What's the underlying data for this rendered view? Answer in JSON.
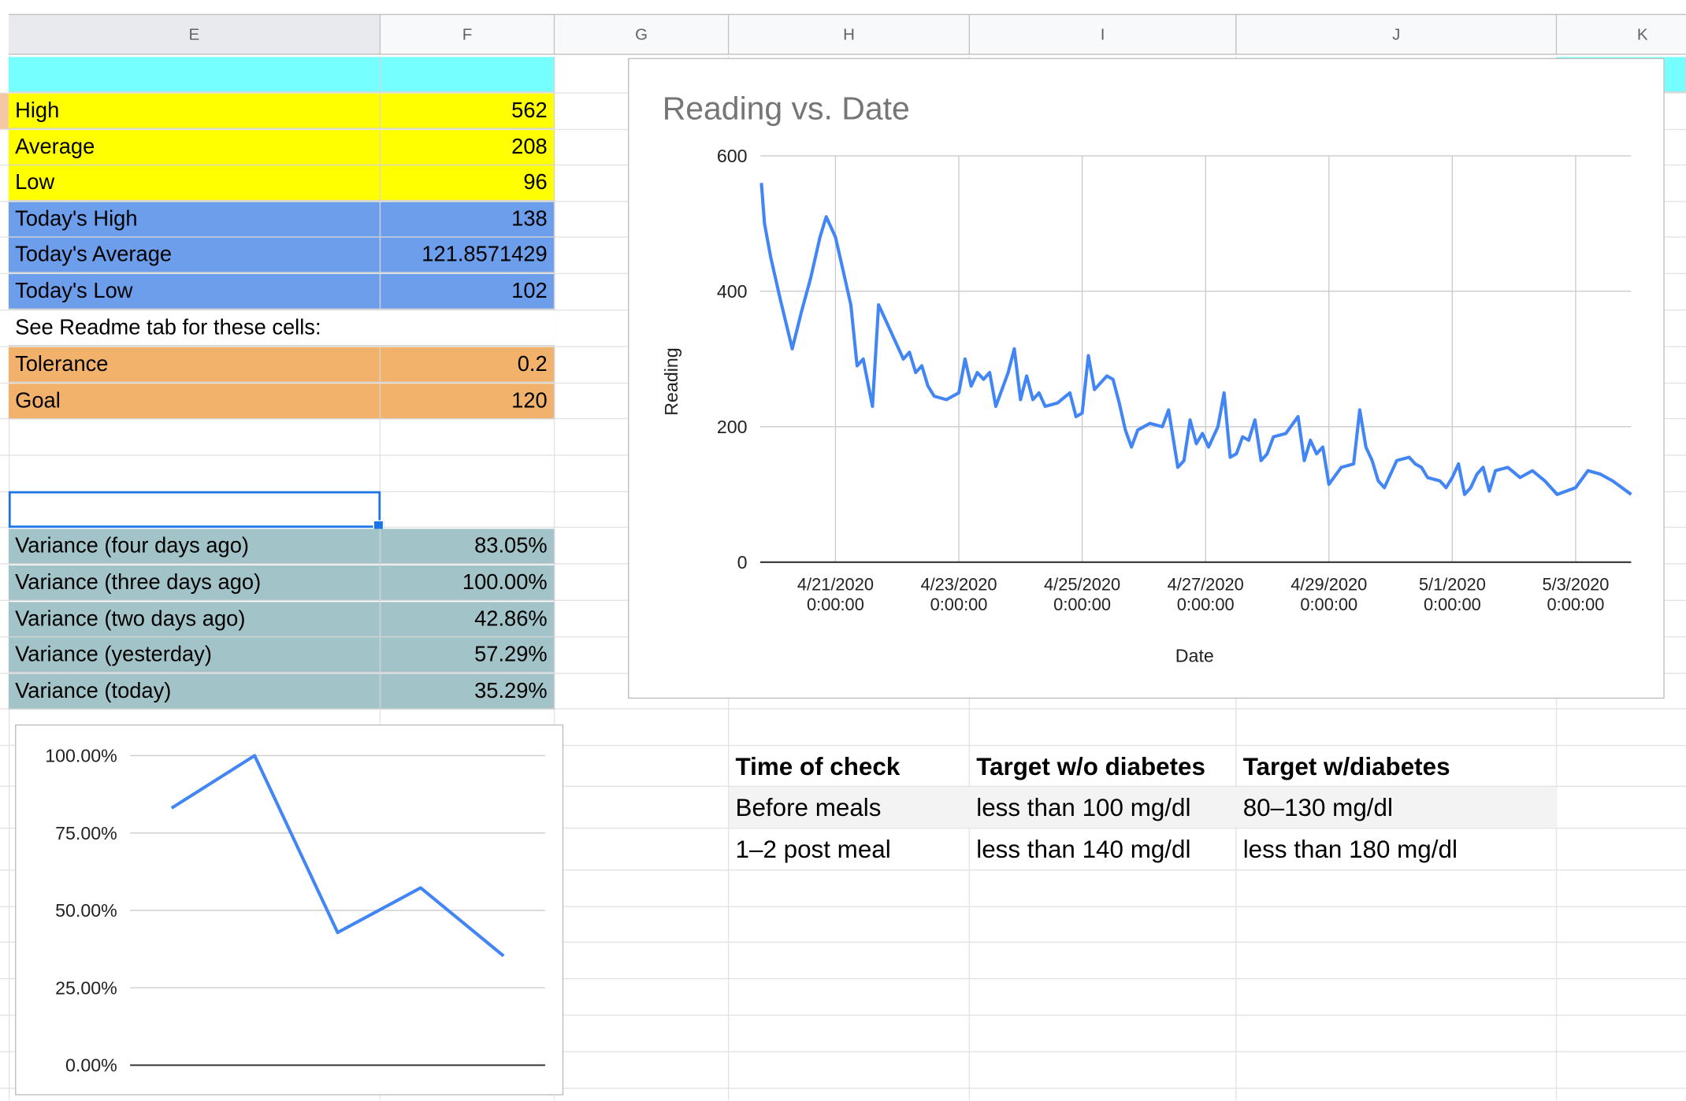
{
  "columns": [
    "E",
    "F",
    "G",
    "H",
    "I",
    "J",
    "K"
  ],
  "summary": {
    "high_label": "High",
    "high_value": "562",
    "average_label": "Average",
    "average_value": "208",
    "low_label": "Low",
    "low_value": "96",
    "today_high_label": "Today's High",
    "today_high_value": "138",
    "today_avg_label": "Today's Average",
    "today_avg_value": "121.8571429",
    "today_low_label": "Today's Low",
    "today_low_value": "102",
    "readme_note": "See Readme tab for these cells:",
    "tolerance_label": "Tolerance",
    "tolerance_value": "0.2",
    "goal_label": "Goal",
    "goal_value": "120"
  },
  "variance": [
    {
      "label": "Variance (four days ago)",
      "value": "83.05%"
    },
    {
      "label": "Variance (three days ago)",
      "value": "100.00%"
    },
    {
      "label": "Variance (two days ago)",
      "value": "42.86%"
    },
    {
      "label": "Variance (yesterday)",
      "value": "57.29%"
    },
    {
      "label": "Variance (today)",
      "value": "35.29%"
    }
  ],
  "reference_table": {
    "headers": [
      "Time of check",
      "Target w/o diabetes",
      "Target w/diabetes"
    ],
    "rows": [
      [
        "Before meals",
        "less than 100 mg/dl",
        "80–130 mg/dl"
      ],
      [
        "1–2 post meal",
        "less than 140 mg/dl",
        "less than 180 mg/dl"
      ]
    ]
  },
  "colors": {
    "yellow": "#ffff00",
    "blue": "#6d9eeb",
    "orange": "#f2b26b",
    "teal": "#a2c4c9",
    "cyan": "#76ffff",
    "series": "#4285f4",
    "selection": "#1a73e8"
  },
  "chart_data": [
    {
      "type": "line",
      "title": "Reading vs. Date",
      "xlabel": "Date",
      "ylabel": "Reading",
      "ylim": [
        0,
        600
      ],
      "yticks": [
        "0",
        "200",
        "400",
        "600"
      ],
      "xticks": [
        [
          "4/21/2020",
          "0:00:00"
        ],
        [
          "4/23/2020",
          "0:00:00"
        ],
        [
          "4/25/2020",
          "0:00:00"
        ],
        [
          "4/27/2020",
          "0:00:00"
        ],
        [
          "4/29/2020",
          "0:00:00"
        ],
        [
          "5/1/2020",
          "0:00:00"
        ],
        [
          "5/3/2020",
          "0:00:00"
        ]
      ],
      "xtick_days": [
        1,
        3,
        5,
        7,
        9,
        11,
        13
      ],
      "xlim_days": [
        -0.22,
        13.9
      ],
      "series": [
        {
          "points": [
            [
              -0.2,
              560
            ],
            [
              -0.15,
              500
            ],
            [
              -0.05,
              450
            ],
            [
              0.1,
              390
            ],
            [
              0.3,
              315
            ],
            [
              0.45,
              370
            ],
            [
              0.6,
              420
            ],
            [
              0.75,
              480
            ],
            [
              0.85,
              510
            ],
            [
              1.0,
              480
            ],
            [
              1.15,
              420
            ],
            [
              1.25,
              380
            ],
            [
              1.35,
              290
            ],
            [
              1.45,
              300
            ],
            [
              1.6,
              230
            ],
            [
              1.7,
              380
            ],
            [
              1.8,
              360
            ],
            [
              1.95,
              330
            ],
            [
              2.1,
              300
            ],
            [
              2.2,
              310
            ],
            [
              2.3,
              280
            ],
            [
              2.4,
              290
            ],
            [
              2.5,
              260
            ],
            [
              2.6,
              245
            ],
            [
              2.8,
              240
            ],
            [
              3.0,
              250
            ],
            [
              3.1,
              300
            ],
            [
              3.2,
              260
            ],
            [
              3.3,
              280
            ],
            [
              3.4,
              270
            ],
            [
              3.5,
              280
            ],
            [
              3.6,
              230
            ],
            [
              3.8,
              280
            ],
            [
              3.9,
              315
            ],
            [
              4.0,
              240
            ],
            [
              4.1,
              275
            ],
            [
              4.2,
              240
            ],
            [
              4.3,
              250
            ],
            [
              4.4,
              230
            ],
            [
              4.6,
              235
            ],
            [
              4.8,
              250
            ],
            [
              4.9,
              215
            ],
            [
              5.0,
              220
            ],
            [
              5.1,
              305
            ],
            [
              5.2,
              255
            ],
            [
              5.4,
              275
            ],
            [
              5.5,
              270
            ],
            [
              5.6,
              235
            ],
            [
              5.7,
              195
            ],
            [
              5.8,
              170
            ],
            [
              5.9,
              195
            ],
            [
              6.1,
              205
            ],
            [
              6.3,
              200
            ],
            [
              6.4,
              225
            ],
            [
              6.55,
              140
            ],
            [
              6.65,
              150
            ],
            [
              6.75,
              210
            ],
            [
              6.85,
              175
            ],
            [
              6.95,
              190
            ],
            [
              7.05,
              170
            ],
            [
              7.2,
              200
            ],
            [
              7.3,
              250
            ],
            [
              7.4,
              155
            ],
            [
              7.5,
              160
            ],
            [
              7.6,
              185
            ],
            [
              7.7,
              180
            ],
            [
              7.8,
              210
            ],
            [
              7.9,
              150
            ],
            [
              8.0,
              160
            ],
            [
              8.1,
              185
            ],
            [
              8.3,
              190
            ],
            [
              8.5,
              215
            ],
            [
              8.6,
              150
            ],
            [
              8.7,
              180
            ],
            [
              8.8,
              160
            ],
            [
              8.9,
              170
            ],
            [
              9.0,
              115
            ],
            [
              9.2,
              140
            ],
            [
              9.4,
              145
            ],
            [
              9.5,
              225
            ],
            [
              9.6,
              170
            ],
            [
              9.7,
              150
            ],
            [
              9.8,
              120
            ],
            [
              9.9,
              110
            ],
            [
              10.1,
              150
            ],
            [
              10.3,
              155
            ],
            [
              10.4,
              145
            ],
            [
              10.5,
              140
            ],
            [
              10.6,
              125
            ],
            [
              10.8,
              120
            ],
            [
              10.9,
              110
            ],
            [
              11.0,
              125
            ],
            [
              11.1,
              145
            ],
            [
              11.2,
              100
            ],
            [
              11.3,
              110
            ],
            [
              11.4,
              130
            ],
            [
              11.5,
              140
            ],
            [
              11.6,
              105
            ],
            [
              11.7,
              135
            ],
            [
              11.9,
              140
            ],
            [
              12.1,
              125
            ],
            [
              12.3,
              135
            ],
            [
              12.5,
              120
            ],
            [
              12.7,
              100
            ],
            [
              13.0,
              110
            ],
            [
              13.2,
              135
            ],
            [
              13.4,
              130
            ],
            [
              13.6,
              120
            ],
            [
              13.9,
              100
            ]
          ]
        }
      ]
    },
    {
      "type": "line",
      "ylim": [
        0,
        100
      ],
      "yticks": [
        "0.00%",
        "25.00%",
        "50.00%",
        "75.00%",
        "100.00%"
      ],
      "series": [
        {
          "values": [
            83.05,
            100.0,
            42.86,
            57.29,
            35.29
          ]
        }
      ]
    }
  ]
}
